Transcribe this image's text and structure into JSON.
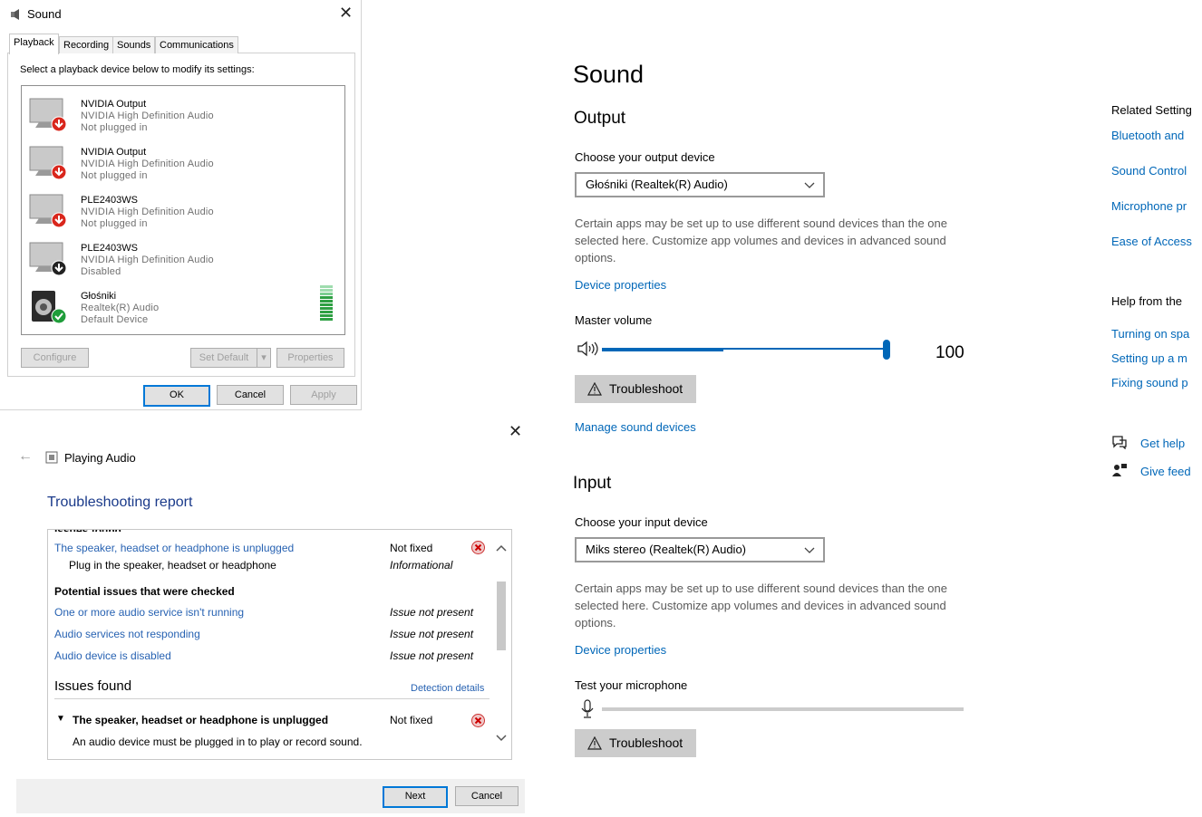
{
  "sound_dialog": {
    "title": "Sound",
    "tabs": [
      "Playback",
      "Recording",
      "Sounds",
      "Communications"
    ],
    "instruction": "Select a playback device below to modify its settings:",
    "devices": [
      {
        "name": "NVIDIA Output",
        "driver": "NVIDIA High Definition Audio",
        "status": "Not plugged in",
        "badge": "red-down-arrow-icon"
      },
      {
        "name": "NVIDIA Output",
        "driver": "NVIDIA High Definition Audio",
        "status": "Not plugged in",
        "badge": "red-down-arrow-icon"
      },
      {
        "name": "PLE2403WS",
        "driver": "NVIDIA High Definition Audio",
        "status": "Not plugged in",
        "badge": "red-down-arrow-icon"
      },
      {
        "name": "PLE2403WS",
        "driver": "NVIDIA High Definition Audio",
        "status": "Disabled",
        "badge": "black-down-arrow-icon"
      },
      {
        "name": "Głośniki",
        "driver": "Realtek(R) Audio",
        "status": "Default Device",
        "badge": "green-check-icon"
      }
    ],
    "buttons": {
      "configure": "Configure",
      "set_default": "Set Default",
      "properties": "Properties",
      "ok": "OK",
      "cancel": "Cancel",
      "apply": "Apply"
    }
  },
  "troubleshooter": {
    "app_title": "Playing Audio",
    "heading": "Troubleshooting report",
    "rows": [
      {
        "issue": "The speaker, headset or headphone is unplugged",
        "status": "Not fixed",
        "detail": "Plug in the speaker, headset or headphone",
        "detail_status": "Informational"
      }
    ],
    "potential_heading": "Potential issues that were checked",
    "potential": [
      {
        "issue": "One or more audio service isn't running",
        "status": "Issue not present"
      },
      {
        "issue": "Audio services not responding",
        "status": "Issue not present"
      },
      {
        "issue": "Audio device is disabled",
        "status": "Issue not present"
      }
    ],
    "issues_found": "Issues found",
    "detection_details": "Detection details",
    "found_item": {
      "issue": "The speaker, headset or headphone is unplugged",
      "status": "Not fixed",
      "detail": "An audio device must be plugged in to play or record sound."
    },
    "buttons": {
      "next": "Next",
      "cancel": "Cancel"
    }
  },
  "settings": {
    "title": "Sound",
    "output": {
      "heading": "Output",
      "choose_label": "Choose your output device",
      "device": "Głośniki (Realtek(R) Audio)",
      "desc": "Certain apps may be set up to use different sound devices than the one selected here. Customize app volumes and devices in advanced sound options.",
      "device_properties": "Device properties",
      "master_volume_label": "Master volume",
      "volume": 100,
      "volume_text": "100",
      "troubleshoot": "Troubleshoot",
      "manage": "Manage sound devices"
    },
    "input": {
      "heading": "Input",
      "choose_label": "Choose your input device",
      "device": "Miks stereo (Realtek(R) Audio)",
      "desc": "Certain apps may be set up to use different sound devices than the one selected here. Customize app volumes and devices in advanced sound options.",
      "device_properties": "Device properties",
      "test_label": "Test your microphone",
      "mic_level": 0,
      "troubleshoot": "Troubleshoot"
    },
    "related": {
      "heading": "Related Setting",
      "links": [
        "Bluetooth and",
        "Sound Control",
        "Microphone pr",
        "Ease of Access"
      ]
    },
    "help": {
      "heading": "Help from the",
      "links": [
        "Turning on spa",
        "Setting up a m",
        "Fixing sound p"
      ]
    },
    "get_help": "Get help",
    "give_feedback": "Give feed",
    "accent": "#0067b8"
  }
}
